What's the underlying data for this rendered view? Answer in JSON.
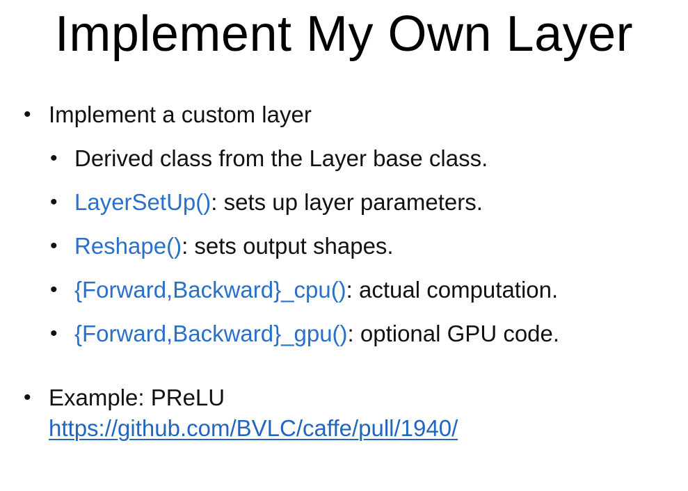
{
  "slide": {
    "title": "Implement My Own Layer",
    "bullets": [
      {
        "text": "Implement a custom layer",
        "sub": [
          {
            "code": "",
            "text": "Derived class from the Layer base class."
          },
          {
            "code": "LayerSetUp()",
            "text": ": sets up layer parameters."
          },
          {
            "code": "Reshape()",
            "text": ": sets output shapes."
          },
          {
            "code": "{Forward,Backward}_cpu()",
            "text": ": actual computation."
          },
          {
            "code": "{Forward,Backward}_gpu()",
            "text": ": optional GPU code."
          }
        ]
      },
      {
        "text": "Example: PReLU",
        "link": "https://github.com/BVLC/caffe/pull/1940/"
      }
    ],
    "bullet_glyph": "•"
  },
  "colors": {
    "code": "#2a6fc9",
    "link": "#1f66c1",
    "text": "#111111"
  }
}
